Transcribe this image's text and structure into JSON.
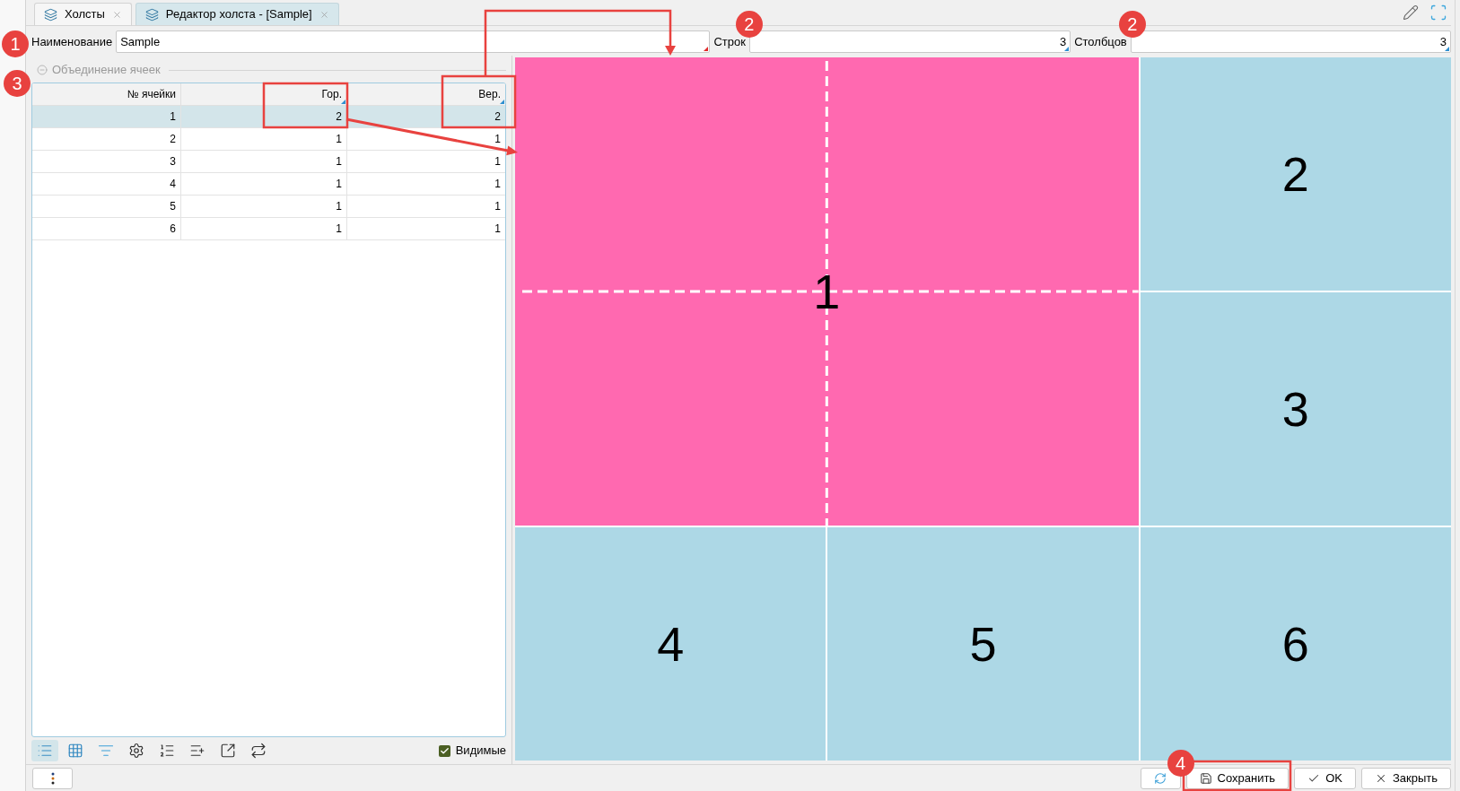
{
  "tabs": [
    {
      "label": "Холсты",
      "selected": false
    },
    {
      "label": "Редактор холста - [Sample]",
      "selected": true
    }
  ],
  "form": {
    "name": {
      "label": "Наименование",
      "value": "Sample",
      "required": true,
      "callout": "1"
    },
    "rows": {
      "label": "Строк",
      "value": "3",
      "required": false,
      "callout": "2"
    },
    "columns": {
      "label": "Столбцов",
      "value": "3",
      "required": false,
      "callout": "2"
    }
  },
  "merge_group": {
    "title": "Объединение ячеек",
    "expanded": true,
    "callout": "3",
    "table": {
      "columns": [
        {
          "label": "№ ячейки",
          "editable": false
        },
        {
          "label": "Гор.",
          "editable": true
        },
        {
          "label": "Вер.",
          "editable": true
        }
      ],
      "rows": [
        {
          "cells": [
            "1",
            "2",
            "2"
          ],
          "selected": true
        },
        {
          "cells": [
            "2",
            "1",
            "1"
          ],
          "selected": false
        },
        {
          "cells": [
            "3",
            "1",
            "1"
          ],
          "selected": false
        },
        {
          "cells": [
            "4",
            "1",
            "1"
          ],
          "selected": false
        },
        {
          "cells": [
            "5",
            "1",
            "1"
          ],
          "selected": false
        },
        {
          "cells": [
            "6",
            "1",
            "1"
          ],
          "selected": false
        }
      ]
    }
  },
  "toolbar": {
    "tools": [
      {
        "kind": "list",
        "selected": true
      },
      {
        "kind": "grid",
        "selected": false
      },
      {
        "kind": "filter",
        "selected": false
      },
      {
        "kind": "settings",
        "selected": false
      },
      {
        "kind": "numbered",
        "selected": false
      },
      {
        "kind": "add-row",
        "selected": false
      },
      {
        "kind": "export",
        "selected": false
      },
      {
        "kind": "swap",
        "selected": false
      }
    ],
    "visible_checkbox": {
      "label": "Видимые",
      "checked": true
    }
  },
  "canvas": {
    "cells": [
      {
        "label": "1",
        "color": "#ff69b0"
      },
      {
        "label": "2",
        "color": "#add8e6"
      },
      {
        "label": "3",
        "color": "#add8e6"
      },
      {
        "label": "4",
        "color": "#add8e6"
      },
      {
        "label": "5",
        "color": "#add8e6"
      },
      {
        "label": "6",
        "color": "#add8e6"
      }
    ]
  },
  "footer": {
    "left_buttons": [
      {
        "kind": "more"
      }
    ],
    "right_buttons": [
      {
        "kind": "refresh"
      },
      {
        "kind": "save",
        "label": "Сохранить",
        "callout": "4"
      },
      {
        "kind": "ok",
        "label": "OK"
      },
      {
        "kind": "close",
        "label": "Закрыть"
      }
    ]
  }
}
